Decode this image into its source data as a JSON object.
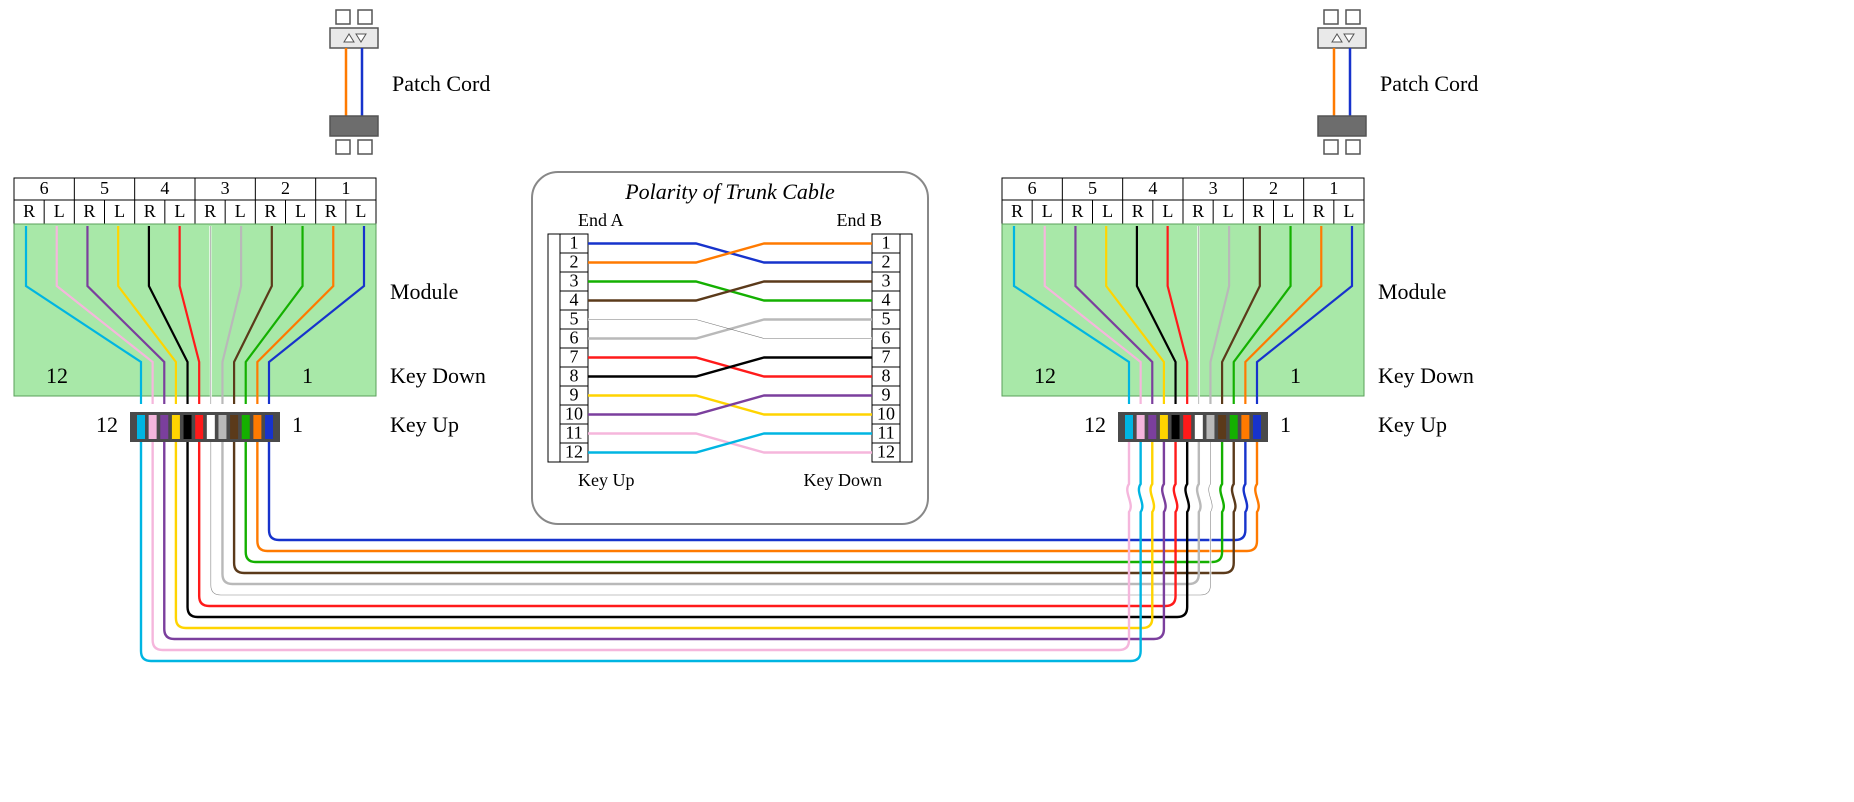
{
  "patchCordLabel": "Patch Cord",
  "moduleLabel": "Module",
  "keyDown": "Key Down",
  "keyUp": "Key Up",
  "trunk": {
    "title": "Polarity of Trunk Cable",
    "endA": "End A",
    "endB": "End B",
    "keyUp": "Key Up",
    "keyDown": "Key Down",
    "rows": [
      "1",
      "2",
      "3",
      "4",
      "5",
      "6",
      "7",
      "8",
      "9",
      "10",
      "11",
      "12"
    ]
  },
  "header": {
    "groups": [
      "6",
      "5",
      "4",
      "3",
      "2",
      "1"
    ],
    "cells": [
      "R",
      "L"
    ]
  },
  "moduleNum": {
    "left": "12",
    "right": "1"
  },
  "connNum": {
    "left": "12",
    "right": "1"
  },
  "fiberColors": [
    "#00b5e2",
    "#f5b6dc",
    "#7b3f9d",
    "#ffd400",
    "#000000",
    "#ff1a1a",
    "#ffffff",
    "#b9b9b9",
    "#5b3a1a",
    "#14b000",
    "#ff7a00",
    "#1733cc"
  ],
  "trunkPairs": [
    [
      "#1733cc",
      "#ff7a00"
    ],
    [
      "#14b000",
      "#5b3a1a"
    ],
    [
      "#ffffff",
      "#b9b9b9"
    ],
    [
      "#ff1a1a",
      "#000000"
    ],
    [
      "#ffd400",
      "#7b3f9d"
    ],
    [
      "#f5b6dc",
      "#00b5e2"
    ]
  ]
}
